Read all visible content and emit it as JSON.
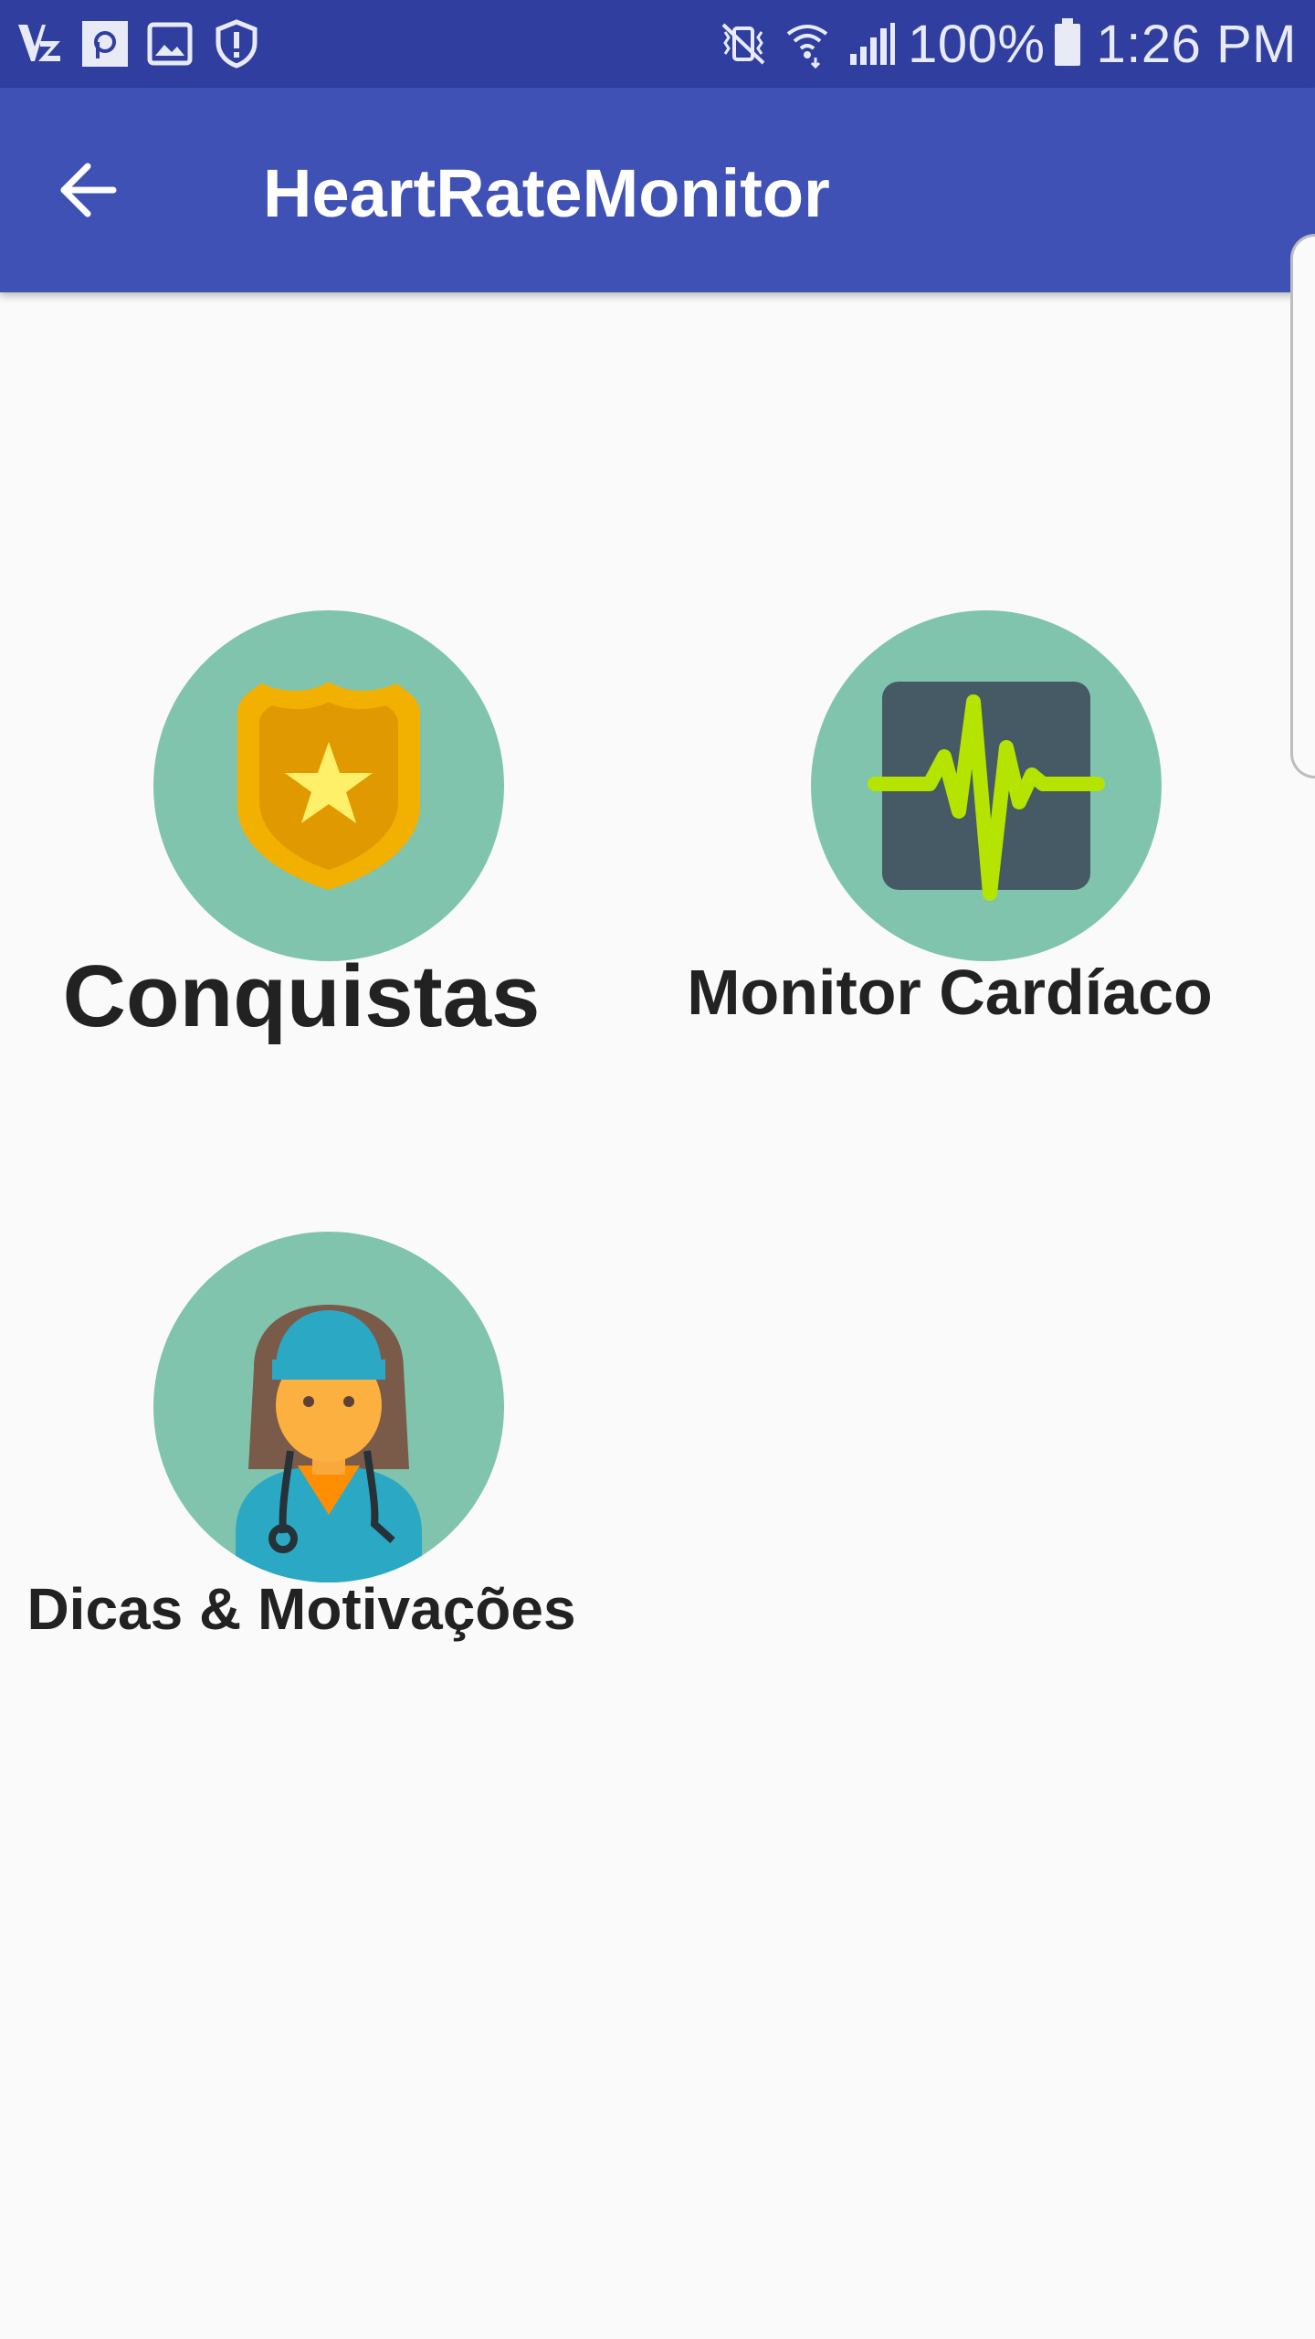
{
  "status_bar": {
    "left_icons": [
      "app-notification-icon",
      "parking-icon",
      "image-icon",
      "shield-alert-icon"
    ],
    "right_icons": [
      "vibrate-mute-icon",
      "wifi-icon",
      "signal-icon",
      "battery-icon"
    ],
    "battery": "100%",
    "time": "1:26 PM"
  },
  "app_bar": {
    "back_icon": "arrow-back-icon",
    "title": "HeartRateMonitor",
    "background_color": "#3f51b5",
    "status_color": "#303f9f"
  },
  "menu": {
    "items": [
      {
        "label": "Conquistas",
        "icon": "police-badge-icon"
      },
      {
        "label": "Monitor Cardíaco",
        "icon": "heart-monitor-icon"
      },
      {
        "label": "Dicas & Motivações",
        "icon": "doctor-icon"
      }
    ],
    "circle_color": "#80c4ae"
  }
}
